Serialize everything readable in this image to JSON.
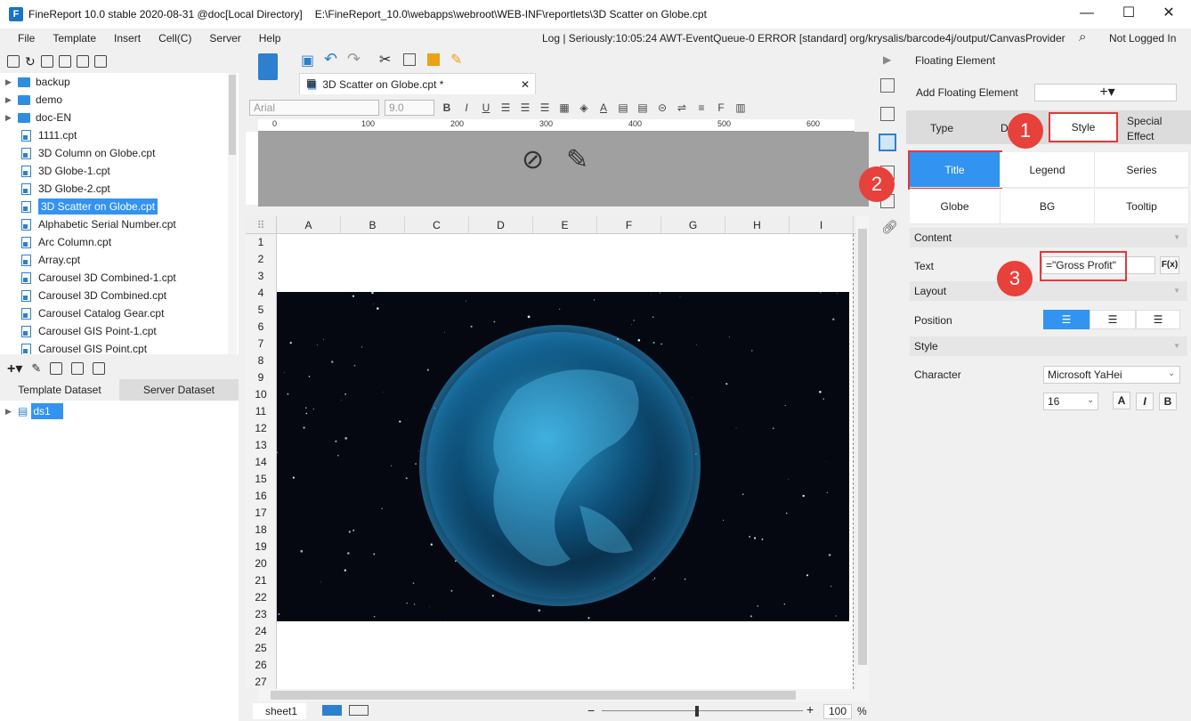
{
  "window": {
    "title": "FineReport 10.0 stable 2020-08-31 @doc[Local Directory]",
    "path": "E:\\FineReport_10.0\\webapps\\webroot\\WEB-INF\\reportlets\\3D Scatter on Globe.cpt"
  },
  "menu": [
    "File",
    "Template",
    "Insert",
    "Cell(C)",
    "Server",
    "Help"
  ],
  "log": "Log | Seriously:10:05:24 AWT-EventQueue-0 ERROR [standard] org/krysalis/barcode4j/output/CanvasProvider",
  "login": "Not Logged In",
  "tree": {
    "folders": [
      "backup",
      "demo",
      "doc-EN"
    ],
    "files": [
      "1111.cpt",
      "3D Column on Globe.cpt",
      "3D Globe-1.cpt",
      "3D Globe-2.cpt",
      "3D Scatter on Globe.cpt",
      "Alphabetic Serial Number.cpt",
      "Arc Column.cpt",
      "Array.cpt",
      "Carousel 3D Combined-1.cpt",
      "Carousel 3D Combined.cpt",
      "Carousel Catalog Gear.cpt",
      "Carousel GIS Point-1.cpt",
      "Carousel GIS Point.cpt"
    ]
  },
  "dataset_tabs": [
    "Template Dataset",
    "Server Dataset"
  ],
  "dataset_items": [
    "ds1"
  ],
  "doc_tab": "3D Scatter on Globe.cpt *",
  "format": {
    "font": "Arial",
    "size": "9.0"
  },
  "ruler_ticks": [
    "0",
    "100",
    "200",
    "300",
    "400",
    "500",
    "600"
  ],
  "columns": [
    "A",
    "B",
    "C",
    "D",
    "E",
    "F",
    "G",
    "H",
    "I"
  ],
  "rows": [
    "1",
    "2",
    "3",
    "4",
    "5",
    "6",
    "7",
    "8",
    "9",
    "10",
    "11",
    "12",
    "13",
    "14",
    "15",
    "16",
    "17",
    "18",
    "19",
    "20",
    "21",
    "22",
    "23",
    "24",
    "25",
    "26",
    "27"
  ],
  "sheet_tab": "sheet1",
  "zoom": {
    "value": "100",
    "unit": "%"
  },
  "panel": {
    "title": "Floating Element",
    "add_label": "Add Floating Element",
    "tabs": [
      "Type",
      "D",
      "Style",
      "Special Effect"
    ],
    "subtabs_row1": [
      "Title",
      "Legend",
      "Series"
    ],
    "subtabs_row2": [
      "Globe",
      "BG",
      "Tooltip"
    ],
    "content_section": "Content",
    "text_label": "Text",
    "text_value": "=\"Gross Profit\"",
    "fx": "F(x)",
    "layout_section": "Layout",
    "position_label": "Position",
    "style_section": "Style",
    "character_label": "Character",
    "font": "Microsoft YaHei",
    "font_size": "16",
    "format_btns": [
      "A",
      "I",
      "B"
    ]
  },
  "badges": [
    "1",
    "2",
    "3"
  ],
  "colors": {
    "accent": "#3393f0",
    "callout": "#e8403b"
  }
}
